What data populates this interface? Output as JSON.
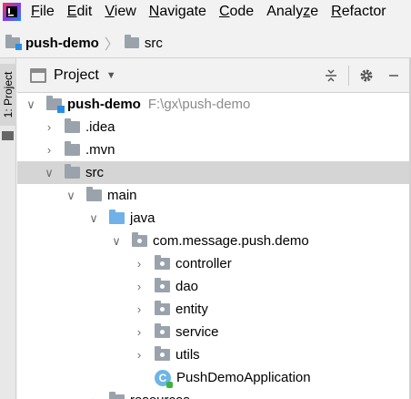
{
  "menubar": {
    "logo": "intellij-logo",
    "items": [
      "File",
      "Edit",
      "View",
      "Navigate",
      "Code",
      "Analyze",
      "Refactor"
    ],
    "mnemonics": [
      "F",
      "E",
      "V",
      "N",
      "C",
      "z",
      "R"
    ]
  },
  "breadcrumb": {
    "project": "push-demo",
    "folder": "src"
  },
  "toolstrip": {
    "tab_label": "1: Project"
  },
  "panel": {
    "title": "Project",
    "caret": "▼",
    "collapse_icon": "collapse-all-icon",
    "settings_icon": "gear-icon",
    "hide_icon": "minimize-icon"
  },
  "tree": {
    "root": {
      "name": "push-demo",
      "path": "F:\\gx\\push-demo"
    },
    "idea": ".idea",
    "mvn": ".mvn",
    "src": "src",
    "main": "main",
    "java": "java",
    "package": "com.message.push.demo",
    "controller": "controller",
    "dao": "dao",
    "entity": "entity",
    "service": "service",
    "utils": "utils",
    "app_class": "PushDemoApplication",
    "app_class_letter": "C",
    "resources": "resources"
  },
  "colors": {
    "selection": "#d5d5d5",
    "folder": "#9aa3ac",
    "source_folder": "#6fb1e8",
    "module_marker": "#2a8ee4"
  }
}
